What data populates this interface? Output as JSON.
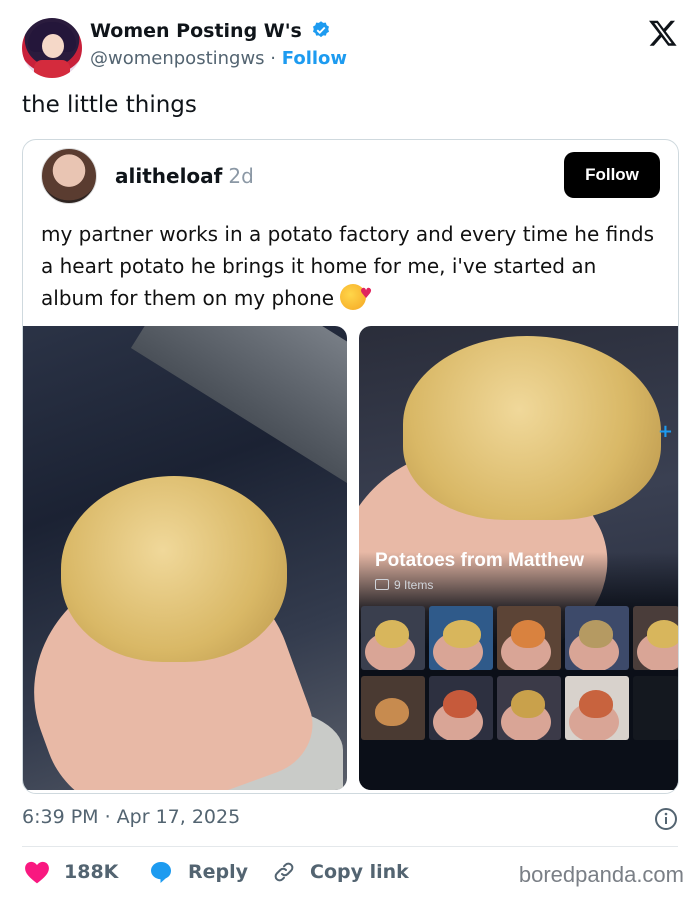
{
  "tweet": {
    "author_name": "Women Posting W's",
    "handle": "@womenpostingws",
    "separator": "·",
    "follow_label": "Follow",
    "text": "the little things",
    "timestamp": "6:39 PM · Apr 17, 2025"
  },
  "quote": {
    "username": "alitheloaf",
    "time_ago": "2d",
    "follow_label": "Follow",
    "text": "my partner works in a potato factory and every time he finds a heart potato he brings it home for me, i've started an album for them on my phone"
  },
  "album": {
    "title": "Potatoes from Matthew",
    "count": "9 Items"
  },
  "actions": {
    "likes": "188K",
    "reply_label": "Reply",
    "copy_link_label": "Copy link"
  },
  "watermark": "boredpanda.com",
  "colors": {
    "link_blue": "#1d9bf0",
    "like_red": "#f91880",
    "text_gray": "#536471"
  }
}
